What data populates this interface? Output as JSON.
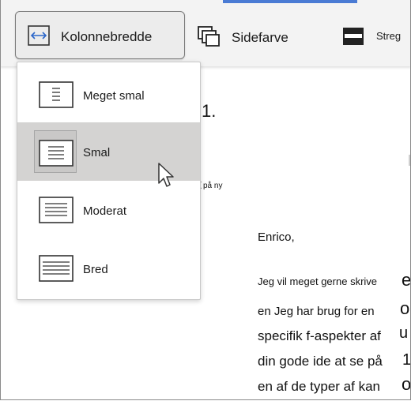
{
  "toolbar": {
    "column_width": {
      "label": "Kolonnebredde",
      "icon": "column-width-icon"
    },
    "page_color": {
      "label": "Sidefarve",
      "icon": "page-color-icon"
    },
    "line_focus": {
      "label": "Streg",
      "icon": "line-focus-icon"
    },
    "accent_color": "#4a7bd4"
  },
  "menu": {
    "items": [
      {
        "label": "Meget smal",
        "icon": "very-narrow-column-icon",
        "selected": false
      },
      {
        "label": "Smal",
        "icon": "narrow-column-icon",
        "selected": true
      },
      {
        "label": "Moderat",
        "icon": "moderate-column-icon",
        "selected": false
      },
      {
        "label": "Bred",
        "icon": "wide-column-icon",
        "selected": false
      }
    ],
    "selected_background": "#d4d3d2"
  },
  "document": {
    "heading_fragment": "1.",
    "small_line_big": "t",
    "small_line_small": "på ny",
    "greeting": "Enrico,",
    "lines": [
      {
        "small": "Jeg vil meget gerne skrive",
        "big": "e"
      },
      {
        "small": "en Jeg har brug for en",
        "big": "o"
      },
      {
        "small": "specifik f-aspekter af",
        "big": "u"
      },
      {
        "small": "din gode ide at se på",
        "big": "1"
      },
      {
        "small": "en af de typer af kan",
        "big": "o"
      }
    ]
  }
}
